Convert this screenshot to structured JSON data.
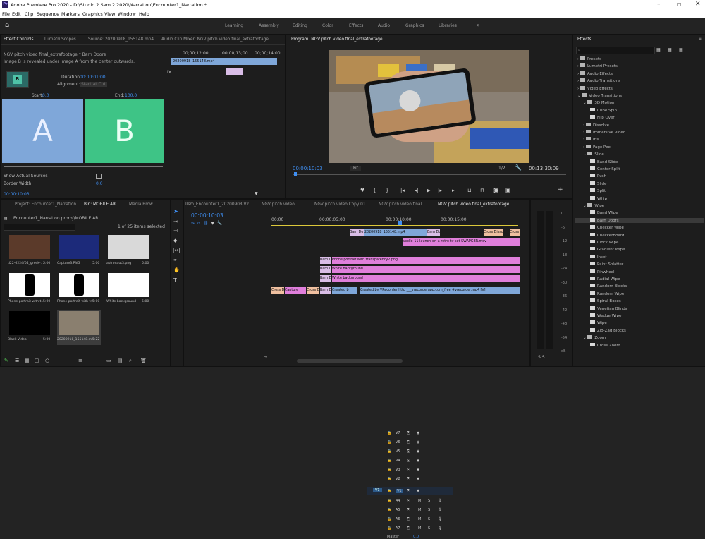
{
  "window": {
    "title": "Adobe Premiere Pro 2020 - D:\\Studio 2 Sem 2 2020\\Narration\\Encounter1_Narration *",
    "app_icon": "Pr"
  },
  "menu": [
    "File",
    "Edit",
    "Clip",
    "Sequence",
    "Markers",
    "Graphics",
    "View",
    "Window",
    "Help"
  ],
  "workspaces": [
    "Learning",
    "Assembly",
    "Editing",
    "Color",
    "Effects",
    "Audio",
    "Graphics",
    "Libraries"
  ],
  "workspace_more": "»",
  "effect_controls": {
    "tabs": [
      "Effect Controls",
      "Lumetri Scopes",
      "Source: 20200918_155148.mp4",
      "Audio Clip Mixer: NGV pitch video final_extrafootage"
    ],
    "clip_title": "NGV pitch video final_extrafootage * Barn Doors",
    "description": "Image B is revealed under image A from the center outwards.",
    "times": [
      "00;00;12;00",
      "00;00;13;00",
      "00;00;14;00"
    ],
    "clip_name": "20200918_155148.mp4",
    "duration_label": "Duration",
    "duration": "00:00:01:00",
    "alignment_label": "Alignment:",
    "alignment": "Start at Cut",
    "start_label": "Start:",
    "start": "0.0",
    "end_label": "End:",
    "end": "100.0",
    "a_label": "A",
    "b_label": "B",
    "icon_letter": "B",
    "show_sources": "Show Actual Sources",
    "border_width": "Border Width",
    "border_value": "0.0",
    "footer_time": "00:00:10:03"
  },
  "program": {
    "tab": "Program: NGV pitch video final_extrafootage",
    "timecode": "00:00:10:03",
    "fit": "Fit",
    "fraction": "1/2",
    "duration": "00:13:30:09"
  },
  "effects": {
    "title": "Effects",
    "items": [
      {
        "label": "Presets",
        "level": 1,
        "type": "folder"
      },
      {
        "label": "Lumetri Presets",
        "level": 1,
        "type": "folder"
      },
      {
        "label": "Audio Effects",
        "level": 1,
        "type": "folder"
      },
      {
        "label": "Audio Transitions",
        "level": 1,
        "type": "folder"
      },
      {
        "label": "Video Effects",
        "level": 1,
        "type": "folder"
      },
      {
        "label": "Video Transitions",
        "level": 1,
        "type": "folder"
      },
      {
        "label": "3D Motion",
        "level": 2,
        "type": "folder"
      },
      {
        "label": "Cube Spin",
        "level": 3,
        "type": "fx"
      },
      {
        "label": "Flip Over",
        "level": 3,
        "type": "fx"
      },
      {
        "label": "Dissolve",
        "level": 2,
        "type": "folder"
      },
      {
        "label": "Immersive Video",
        "level": 2,
        "type": "folder"
      },
      {
        "label": "Iris",
        "level": 2,
        "type": "folder"
      },
      {
        "label": "Page Peel",
        "level": 2,
        "type": "folder"
      },
      {
        "label": "Slide",
        "level": 2,
        "type": "folder"
      },
      {
        "label": "Band Slide",
        "level": 3,
        "type": "fx"
      },
      {
        "label": "Center Split",
        "level": 3,
        "type": "fx"
      },
      {
        "label": "Push",
        "level": 3,
        "type": "fx"
      },
      {
        "label": "Slide",
        "level": 3,
        "type": "fx"
      },
      {
        "label": "Split",
        "level": 3,
        "type": "fx"
      },
      {
        "label": "Whip",
        "level": 3,
        "type": "fx"
      },
      {
        "label": "Wipe",
        "level": 2,
        "type": "folder"
      },
      {
        "label": "Band Wipe",
        "level": 3,
        "type": "fx"
      },
      {
        "label": "Barn Doors",
        "level": 3,
        "type": "fx"
      },
      {
        "label": "Checker Wipe",
        "level": 3,
        "type": "fx"
      },
      {
        "label": "CheckerBoard",
        "level": 3,
        "type": "fx"
      },
      {
        "label": "Clock Wipe",
        "level": 3,
        "type": "fx"
      },
      {
        "label": "Gradient Wipe",
        "level": 3,
        "type": "fx"
      },
      {
        "label": "Inset",
        "level": 3,
        "type": "fx"
      },
      {
        "label": "Paint Splatter",
        "level": 3,
        "type": "fx"
      },
      {
        "label": "Pinwheel",
        "level": 3,
        "type": "fx"
      },
      {
        "label": "Radial Wipe",
        "level": 3,
        "type": "fx"
      },
      {
        "label": "Random Blocks",
        "level": 3,
        "type": "fx"
      },
      {
        "label": "Random Wipe",
        "level": 3,
        "type": "fx"
      },
      {
        "label": "Spiral Boxes",
        "level": 3,
        "type": "fx"
      },
      {
        "label": "Venetian Blinds",
        "level": 3,
        "type": "fx"
      },
      {
        "label": "Wedge Wipe",
        "level": 3,
        "type": "fx"
      },
      {
        "label": "Wipe",
        "level": 3,
        "type": "fx"
      },
      {
        "label": "Zig-Zag Blocks",
        "level": 3,
        "type": "fx"
      },
      {
        "label": "Zoom",
        "level": 2,
        "type": "folder"
      },
      {
        "label": "Cross Zoom",
        "level": 3,
        "type": "fx"
      }
    ]
  },
  "project": {
    "tabs": [
      "Project: Encounter1_Narration",
      "Bin: MOBILE AR",
      "Media Brow"
    ],
    "path": "Encounter1_Narration.prproj\\MOBILE AR",
    "selection": "1 of 25 items selected",
    "thumbs": [
      {
        "name": "d22-6224f04_greek-...",
        "dur": "5:00"
      },
      {
        "name": "Capture3.PNG",
        "dur": "5:00"
      },
      {
        "name": "astronaut3.png",
        "dur": "5:00"
      },
      {
        "name": "Phone portrait with t...",
        "dur": "5:00"
      },
      {
        "name": "Phone portrait with tr...",
        "dur": "5:00"
      },
      {
        "name": "White background",
        "dur": "5:00"
      },
      {
        "name": "Black Video",
        "dur": "5:00"
      },
      {
        "name": "20200918_155148.m...",
        "dur": "5:22"
      }
    ]
  },
  "timeline": {
    "tabs": [
      "Ilsm_Encounter1_20200908 V2",
      "NGV pitch video",
      "NGV pitch video Copy 01",
      "NGV pitch video final",
      "NGV pitch video final_extrafootage"
    ],
    "timecode": "00:00:10:03",
    "ruler": [
      "00:00",
      "00:00:05:00",
      "00:00:10:00",
      "00:00:15:00"
    ],
    "video_tracks": [
      "V7",
      "V6",
      "V5",
      "V4",
      "V3",
      "V2",
      "V1"
    ],
    "audio_tracks": [
      "A4",
      "A5",
      "A6",
      "A7"
    ],
    "master": "Master",
    "master_val": "0.0",
    "source_patch_v": "V1",
    "source_patch_a": "A1",
    "clips": {
      "v7a": "Barn Do",
      "v7b": "20200918_155148.mp4",
      "v7c": "Barn Do",
      "v7d": "Cross Dissol",
      "v7e": "Cross",
      "v6": "apollo-11-launch-on-a-retro-tv-set-SWAPGBR.mov",
      "v4a": "Barn Do",
      "v4b": "Phone portrait with transparency2.png",
      "v3a": "Barn Do",
      "v3b": "White background",
      "v2a": "Barn Do",
      "v2b": "White background",
      "v1a": "Cross D",
      "v1b": "Capture",
      "v1c": "Cross D",
      "v1d": "Barn Do",
      "v1e": "Created b",
      "v1f": "Created by VRecorder http ___vrecorderapp.com_free #vrecorder.mp4 [V]"
    }
  },
  "meters": [
    "0",
    "-6",
    "-12",
    "-18",
    "-24",
    "-30",
    "-36",
    "-42",
    "-48",
    "-54",
    "dB"
  ],
  "meter_bottom": "S  S"
}
